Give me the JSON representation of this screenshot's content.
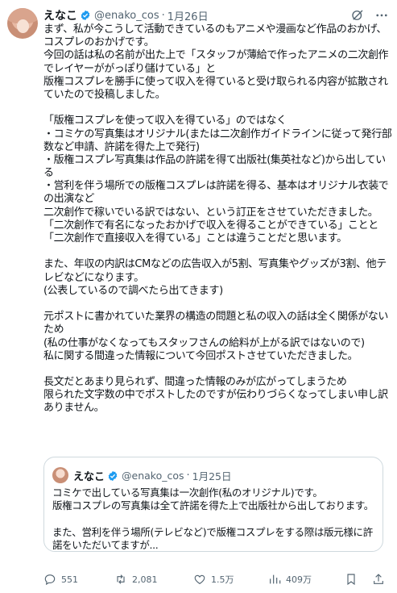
{
  "tweet": {
    "author": {
      "name": "えなこ",
      "handle": "@enako_cos",
      "date": "1月26日"
    },
    "lines": [
      "まず、私が今こうして活動できているのもアニメや漫画など作品のおかげ、",
      "コスプレのおかげです。",
      "今回の話は私の名前が出た上で「スタッフが薄給で作ったアニメの二次創作",
      "でレイヤーががっぽり儲けている」と",
      "版権コスプレを勝手に使って収入を得ていると受け取られる内容が拡散され",
      "ていたので投稿しました。",
      "",
      "「版権コスプレを使って収入を得ている」のではなく",
      "・コミケの写真集はオリジナル(または二次創作ガイドラインに従って発行部",
      "数など申請、許諾を得た上で発行)",
      "・版権コスプレ写真集は作品の許諾を得て出版社(集英社など)から出してい",
      "る",
      "・営利を伴う場所での版権コスプレは許諾を得る、基本はオリジナル衣装で",
      "の出演など",
      "二次創作で稼いでいる訳ではない、という訂正をさせていただきました。",
      "「二次創作で有名になったおかげで収入を得ることができている」ことと",
      "「二次創作で直接収入を得ている」ことは違うことだと思います。",
      "",
      "また、年収の内訳はCMなどの広告収入が5割、写真集やグッズが3割、他テ",
      "レビなどになります。",
      "(公表しているので調べたら出てきます)",
      "",
      "元ポストに書かれていた業界の構造の問題と私の収入の話は全く関係がない",
      "ため",
      "(私の仕事がなくなってもスタッフさんの給料が上がる訳ではないので)",
      "私に関する間違った情報について今回ポストさせていただきました。",
      "",
      "長文だとあまり見られず、間違った情報のみが広がってしまうため",
      "限られた文字数の中でポストしたのですが伝わりづらくなってしまい申し訳",
      "ありません。"
    ]
  },
  "quote": {
    "author": {
      "name": "えなこ",
      "handle": "@enako_cos",
      "date": "1月25日"
    },
    "lines": [
      "コミケで出している写真集は一次創作(私のオリジナル)です。",
      "版権コスプレの写真集は全て許諾を得た上で出版社から出しております。",
      "",
      "また、営利を伴う場所(テレビなど)で版権コスプレをする際は版元様に許",
      "諾をいただいてますが..."
    ]
  },
  "actions": {
    "replies": "551",
    "reposts": "2,081",
    "likes": "1.5万",
    "views": "409万"
  },
  "colors": {
    "verified": "#1d9bf0",
    "muted": "#536471",
    "text": "#0f1419",
    "border": "#cfd9de"
  }
}
